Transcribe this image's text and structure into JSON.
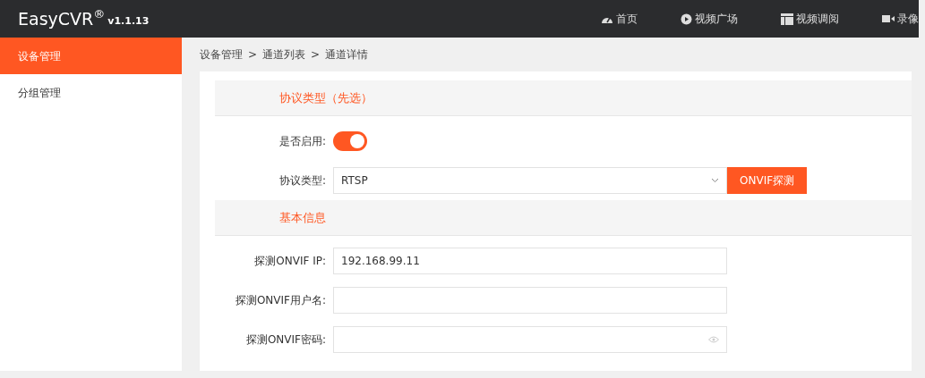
{
  "app": {
    "name": "EasyCVR",
    "mark": "®",
    "version": "v1.1.13"
  },
  "nav": [
    {
      "label": "首页"
    },
    {
      "label": "视频广场"
    },
    {
      "label": "视频调阅"
    },
    {
      "label": "录像"
    }
  ],
  "sidebar": {
    "items": [
      {
        "label": "设备管理",
        "selected": true
      },
      {
        "label": "分组管理",
        "selected": false
      }
    ]
  },
  "breadcrumb": [
    "设备管理",
    ">",
    "通道列表",
    ">",
    "通道详情"
  ],
  "sections": [
    {
      "title": "协议类型（先选）",
      "fields": [
        {
          "kind": "toggle",
          "label": "是否启用:",
          "on": true
        },
        {
          "kind": "select",
          "label": "协议类型:",
          "value": "RTSP",
          "button": "ONVIF探测"
        }
      ]
    },
    {
      "title": "基本信息",
      "fields": [
        {
          "kind": "text",
          "label": "探测ONVIF IP:",
          "value": "192.168.99.11"
        },
        {
          "kind": "text",
          "label": "探测ONVIF用户名:"
        },
        {
          "kind": "password",
          "label": "探测ONVIF密码:"
        }
      ]
    }
  ]
}
